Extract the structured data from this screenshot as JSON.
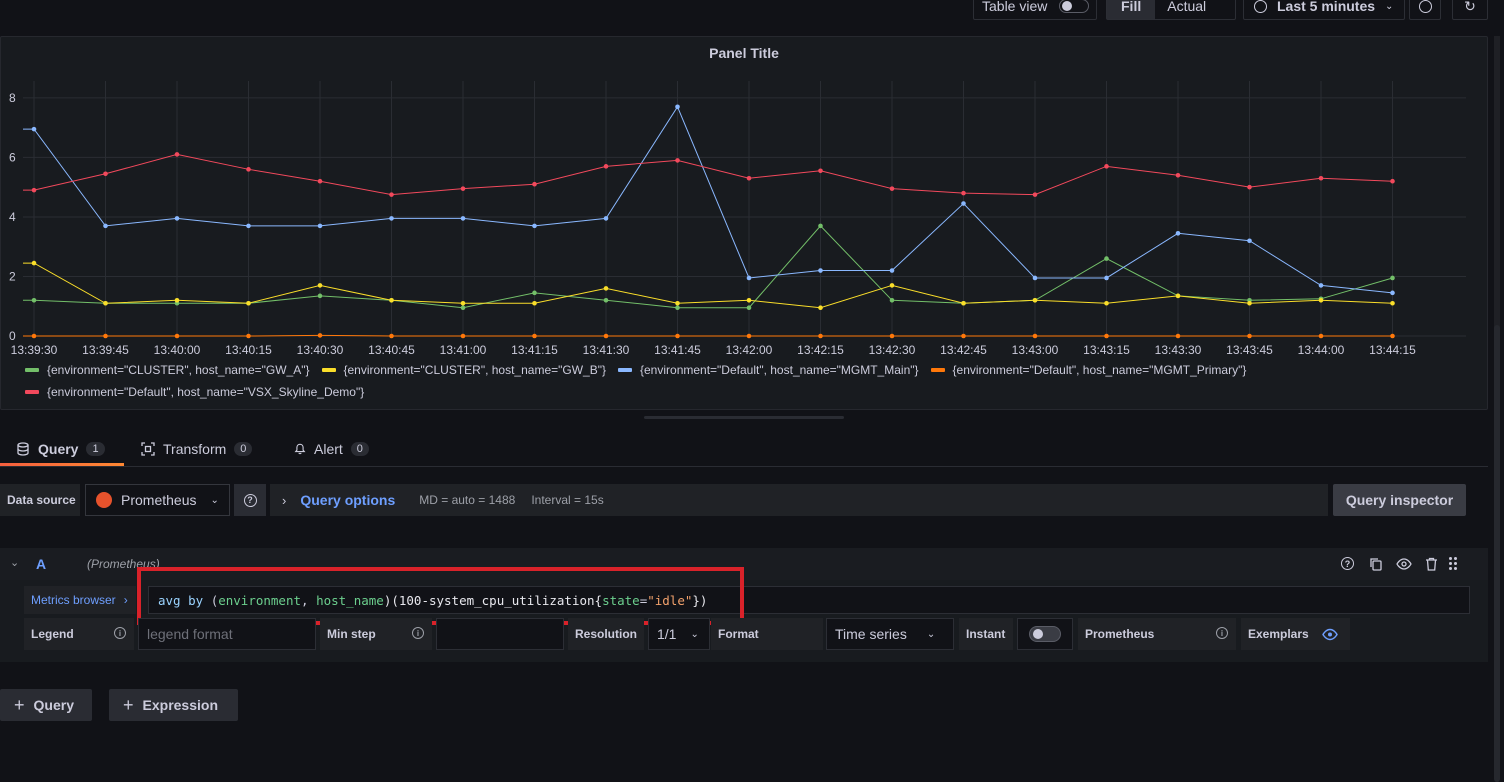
{
  "toolbar": {
    "table_view_label": "Table view",
    "fill_label": "Fill",
    "actual_label": "Actual",
    "time_range_label": "Last 5 minutes"
  },
  "panel": {
    "title": "Panel Title"
  },
  "chart_data": {
    "type": "line",
    "title": "Panel Title",
    "x": [
      "13:39:30",
      "13:39:45",
      "13:40:00",
      "13:40:15",
      "13:40:30",
      "13:40:45",
      "13:41:00",
      "13:41:15",
      "13:41:30",
      "13:41:45",
      "13:42:00",
      "13:42:15",
      "13:42:30",
      "13:42:45",
      "13:43:00",
      "13:43:15",
      "13:43:30",
      "13:43:45",
      "13:44:00",
      "13:44:15"
    ],
    "y_ticks": [
      "0",
      "2",
      "4",
      "6",
      "8"
    ],
    "ylim": [
      0,
      8.5
    ],
    "grid": true,
    "legend_placement": "bottom",
    "series": [
      {
        "name": "{environment=\"CLUSTER\", host_name=\"GW_A\"}",
        "color": "#73bf69",
        "values": [
          1.2,
          1.1,
          1.1,
          1.1,
          1.35,
          1.2,
          0.95,
          1.45,
          1.2,
          0.95,
          0.95,
          3.7,
          1.2,
          1.1,
          1.2,
          2.6,
          1.35,
          1.2,
          1.25,
          1.95
        ]
      },
      {
        "name": "{environment=\"CLUSTER\", host_name=\"GW_B\"}",
        "color": "#fade2a",
        "values": [
          2.45,
          1.1,
          1.2,
          1.1,
          1.7,
          1.2,
          1.1,
          1.1,
          1.6,
          1.1,
          1.2,
          0.95,
          1.7,
          1.1,
          1.2,
          1.1,
          1.35,
          1.1,
          1.2,
          1.1
        ]
      },
      {
        "name": "{environment=\"Default\", host_name=\"MGMT_Main\"}",
        "color": "#8ab8ff",
        "values": [
          6.95,
          3.7,
          3.95,
          3.7,
          3.7,
          3.95,
          3.95,
          3.7,
          3.95,
          7.7,
          1.95,
          2.2,
          2.2,
          4.45,
          1.95,
          1.95,
          3.45,
          3.2,
          1.7,
          1.45
        ]
      },
      {
        "name": "{environment=\"Default\", host_name=\"MGMT_Primary\"}",
        "color": "#ff780a",
        "values": [
          0,
          0,
          0,
          0,
          0.02,
          0,
          0,
          0,
          0,
          0,
          0,
          0,
          0,
          0,
          0,
          0,
          0,
          0,
          0,
          0
        ]
      },
      {
        "name": "{environment=\"Default\", host_name=\"VSX_Skyline_Demo\"}",
        "color": "#f2495c",
        "values": [
          4.9,
          5.45,
          6.1,
          5.6,
          5.2,
          4.75,
          4.95,
          5.1,
          5.7,
          5.9,
          5.3,
          5.55,
          4.95,
          4.8,
          4.75,
          5.7,
          5.4,
          5.0,
          5.3,
          5.2
        ]
      }
    ]
  },
  "tabs": [
    {
      "label": "Query",
      "count": "1",
      "icon": "database-icon"
    },
    {
      "label": "Transform",
      "count": "0",
      "icon": "transform-icon"
    },
    {
      "label": "Alert",
      "count": "0",
      "icon": "bell-icon"
    }
  ],
  "datasource": {
    "label": "Data source",
    "value": "Prometheus",
    "query_options_label": "Query options",
    "md_info": "MD = auto = 1488",
    "interval_info": "Interval = 15s",
    "inspector_label": "Query inspector"
  },
  "query_a": {
    "ref_id": "A",
    "ds_name": "(Prometheus)",
    "metrics_browser_label": "Metrics browser",
    "expr_parts": {
      "p1": "avg by ",
      "p2": "(",
      "p3": "environment",
      "p4": ", ",
      "p5": "host_name",
      "p6": ")(100-system_cpu_utilization{",
      "p7": "state",
      "p8": "=",
      "p9": "\"idle\"",
      "p10": "})"
    },
    "legend_label": "Legend",
    "legend_placeholder": "legend format",
    "min_step_label": "Min step",
    "resolution_label": "Resolution",
    "resolution_value": "1/1",
    "format_label": "Format",
    "format_value": "Time series",
    "instant_label": "Instant",
    "prometheus_label": "Prometheus",
    "exemplars_label": "Exemplars"
  },
  "bottom": {
    "add_query_label": "Query",
    "add_expression_label": "Expression"
  }
}
